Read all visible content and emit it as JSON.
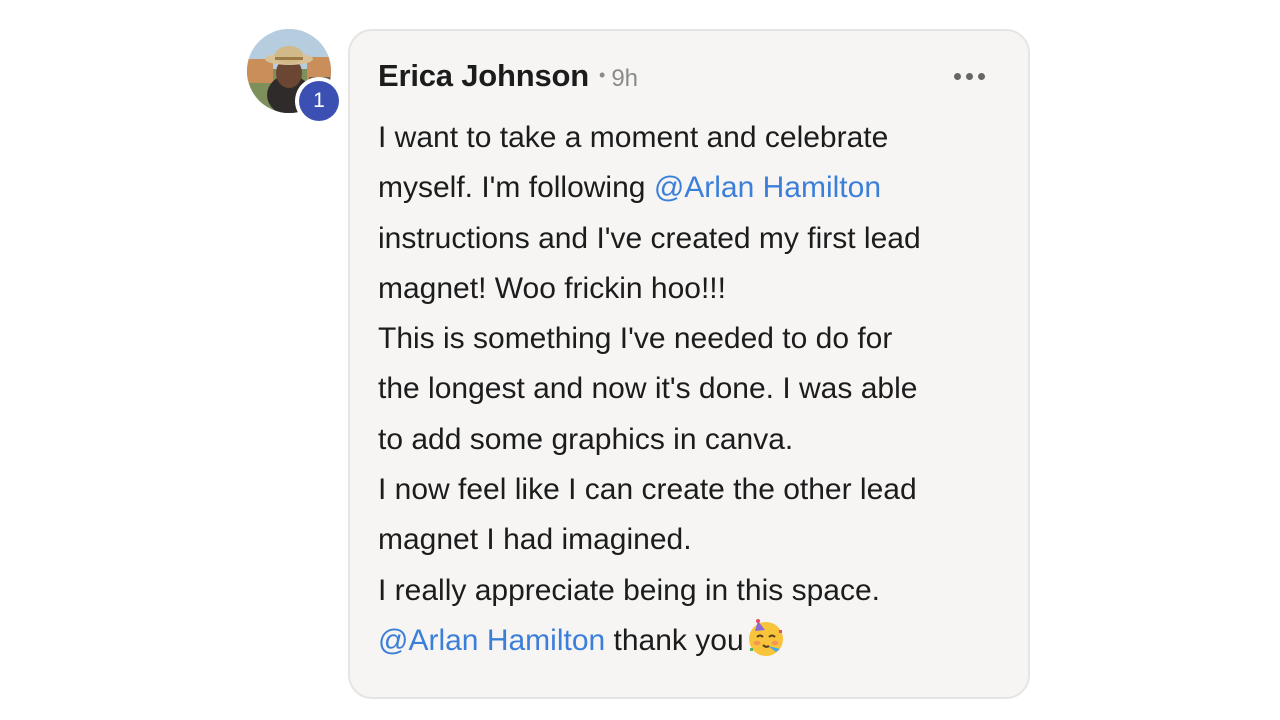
{
  "author": {
    "name": "Erica Johnson",
    "separator": "•",
    "time": "9h",
    "badge": "1",
    "avatar_icon": "avatar-photo"
  },
  "menu": {
    "icon": "more-horizontal-icon"
  },
  "body": {
    "line1": "I want to take a moment and celebrate",
    "line2_before": "myself. I'm following ",
    "line2_mention": "@Arlan Hamilton",
    "line3": "instructions and I've created my first lead",
    "line4": "magnet! Woo frickin hoo!!!",
    "line5": "This is something I've needed to do for",
    "line6": "the longest and now it's done. I was able",
    "line7": "to add some graphics in canva.",
    "line8": "I now feel like I can create the other lead",
    "line9": "magnet I had imagined.",
    "line10": "I really appreciate being in this space.",
    "line11_mention": "@Arlan Hamilton",
    "line11_after": " thank you",
    "line11_emoji": "partying-face-emoji"
  },
  "colors": {
    "mention": "#3c7fd8",
    "badge": "#3b50b2",
    "card_background": "#f6f5f4"
  }
}
